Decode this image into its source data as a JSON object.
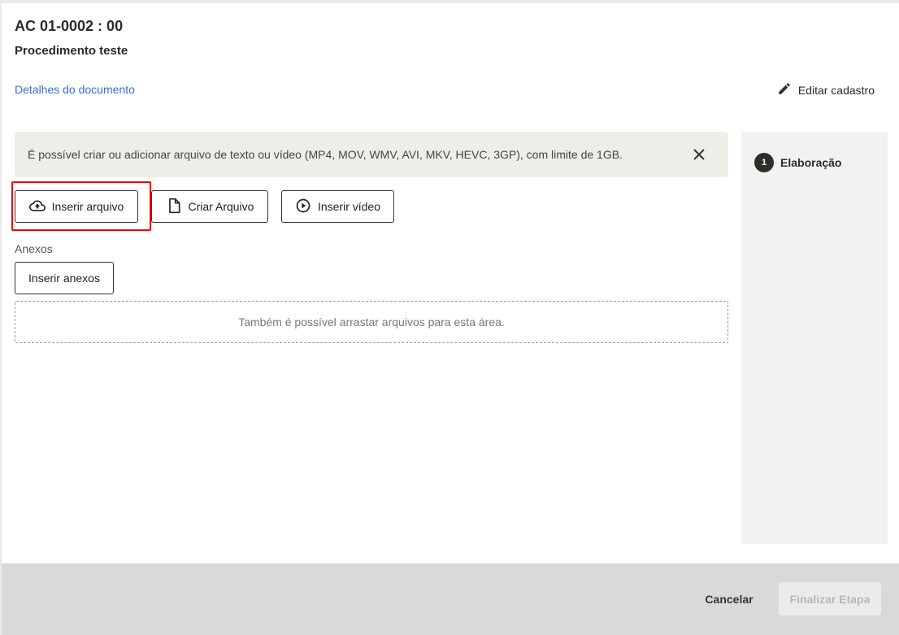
{
  "header": {
    "doc_code": "AC 01-0002 : 00",
    "doc_title": "Procedimento teste",
    "details_link": "Detalhes do documento",
    "edit_label": "Editar cadastro"
  },
  "banner": {
    "text": "É possível criar ou adicionar arquivo de texto ou vídeo (MP4, MOV, WMV, AVI, MKV, HEVC, 3GP), com limite de 1GB."
  },
  "actions": {
    "insert_file": "Inserir arquivo",
    "create_file": "Criar Arquivo",
    "insert_video": "Inserir vídeo"
  },
  "attachments": {
    "label": "Anexos",
    "insert_label": "Inserir anexos",
    "dropzone_text": "Também é possível arrastar arquivos para esta área."
  },
  "sidebar": {
    "steps": [
      {
        "number": "1",
        "label": "Elaboração"
      }
    ]
  },
  "footer": {
    "cancel_label": "Cancelar",
    "finish_label": "Finalizar Etapa"
  },
  "colors": {
    "link": "#3b6fd1",
    "highlight": "#e01010",
    "step_badge": "#2b2f27"
  }
}
